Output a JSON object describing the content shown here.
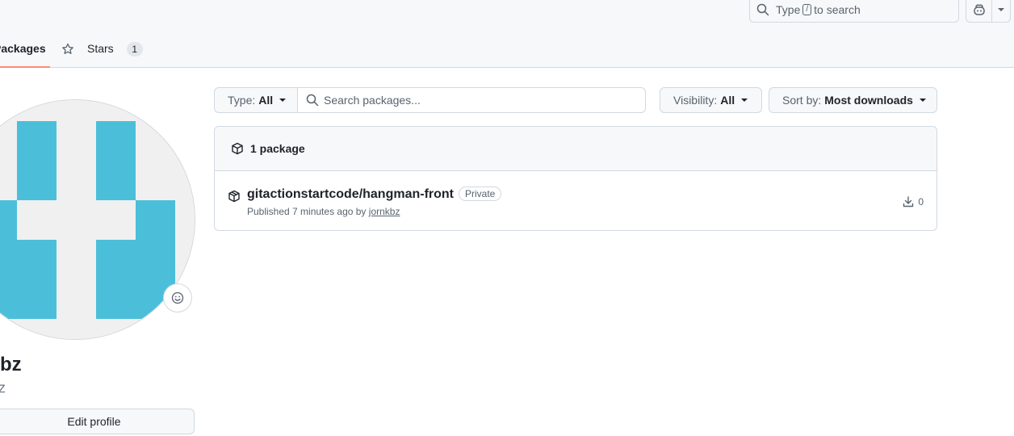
{
  "header": {
    "search": {
      "prefix": "Type",
      "key": "/",
      "suffix": "to search"
    }
  },
  "tabs": [
    {
      "label": "Packages"
    },
    {
      "label": "Stars",
      "count": "1"
    }
  ],
  "profile": {
    "username": "bz",
    "fullname": "Z",
    "edit_label": "Edit profile"
  },
  "filters": {
    "type_label": "Type:",
    "type_value": "All",
    "search_placeholder": "Search packages...",
    "visibility_label": "Visibility:",
    "visibility_value": "All",
    "sort_label": "Sort by:",
    "sort_value": "Most downloads"
  },
  "packages": {
    "count_label": "1 package",
    "items": [
      {
        "name": "gitactionstartcode/hangman-front",
        "badge": "Private",
        "published_prefix": "Published 7 minutes ago by",
        "author": "jornkbz",
        "downloads": "0"
      }
    ]
  },
  "colors": {
    "accent_tab": "#fd8c73",
    "avatar_fill": "#4bbfd9",
    "avatar_bg": "#f0f0f0"
  }
}
